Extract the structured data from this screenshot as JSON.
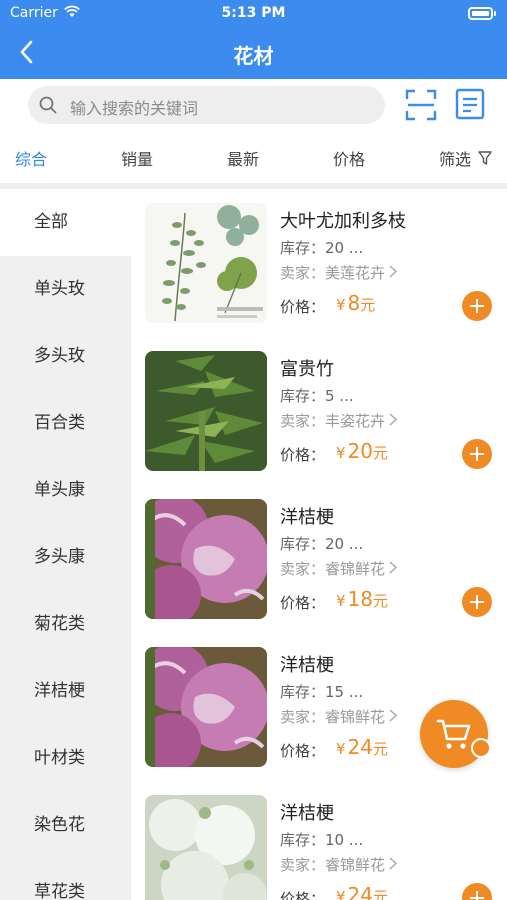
{
  "status_bar": {
    "carrier": "Carrier",
    "time": "5:13 PM"
  },
  "header": {
    "title": "花材"
  },
  "search": {
    "placeholder": "输入搜索的关键词"
  },
  "sort_tabs": [
    {
      "label": "综合",
      "active": true
    },
    {
      "label": "销量",
      "active": false
    },
    {
      "label": "最新",
      "active": false
    },
    {
      "label": "价格",
      "active": false
    },
    {
      "label": "筛选",
      "active": false
    }
  ],
  "categories": [
    {
      "label": "全部",
      "active": true
    },
    {
      "label": "单头玫"
    },
    {
      "label": "多头玫"
    },
    {
      "label": "百合类"
    },
    {
      "label": "单头康"
    },
    {
      "label": "多头康"
    },
    {
      "label": "菊花类"
    },
    {
      "label": "洋桔梗"
    },
    {
      "label": "叶材类"
    },
    {
      "label": "染色花"
    },
    {
      "label": "草花类"
    }
  ],
  "products": [
    {
      "name": "大叶尤加利多枝",
      "stock": "库存：20 ...",
      "seller": "卖家：美莲花卉",
      "price_label": "价格：",
      "currency": "¥",
      "price": "8",
      "unit": "元",
      "image": "eucalyptus"
    },
    {
      "name": "富贵竹",
      "stock": "库存：5 ...",
      "seller": "卖家：丰姿花卉",
      "price_label": "价格：",
      "currency": "¥",
      "price": "20",
      "unit": "元",
      "image": "bamboo"
    },
    {
      "name": "洋桔梗",
      "stock": "库存：20 ...",
      "seller": "卖家：睿锦鲜花",
      "price_label": "价格：",
      "currency": "¥",
      "price": "18",
      "unit": "元",
      "image": "lisianthus-pink"
    },
    {
      "name": "洋桔梗",
      "stock": "库存：15 ...",
      "seller": "卖家：睿锦鲜花",
      "price_label": "价格：",
      "currency": "¥",
      "price": "24",
      "unit": "元",
      "image": "lisianthus-pink"
    },
    {
      "name": "洋桔梗",
      "stock": "库存：10 ...",
      "seller": "卖家：睿锦鲜花",
      "price_label": "价格：",
      "currency": "¥",
      "price": "24",
      "unit": "元",
      "image": "lisianthus-white"
    }
  ],
  "colors": {
    "brand_blue": "#3c8cf0",
    "accent_orange": "#f08a24",
    "active_tab": "#2f86e8"
  },
  "icons": [
    "wifi-icon",
    "battery-icon",
    "back-icon",
    "search-icon",
    "scan-icon",
    "list-icon",
    "filter-icon",
    "add-icon",
    "cart-icon"
  ]
}
